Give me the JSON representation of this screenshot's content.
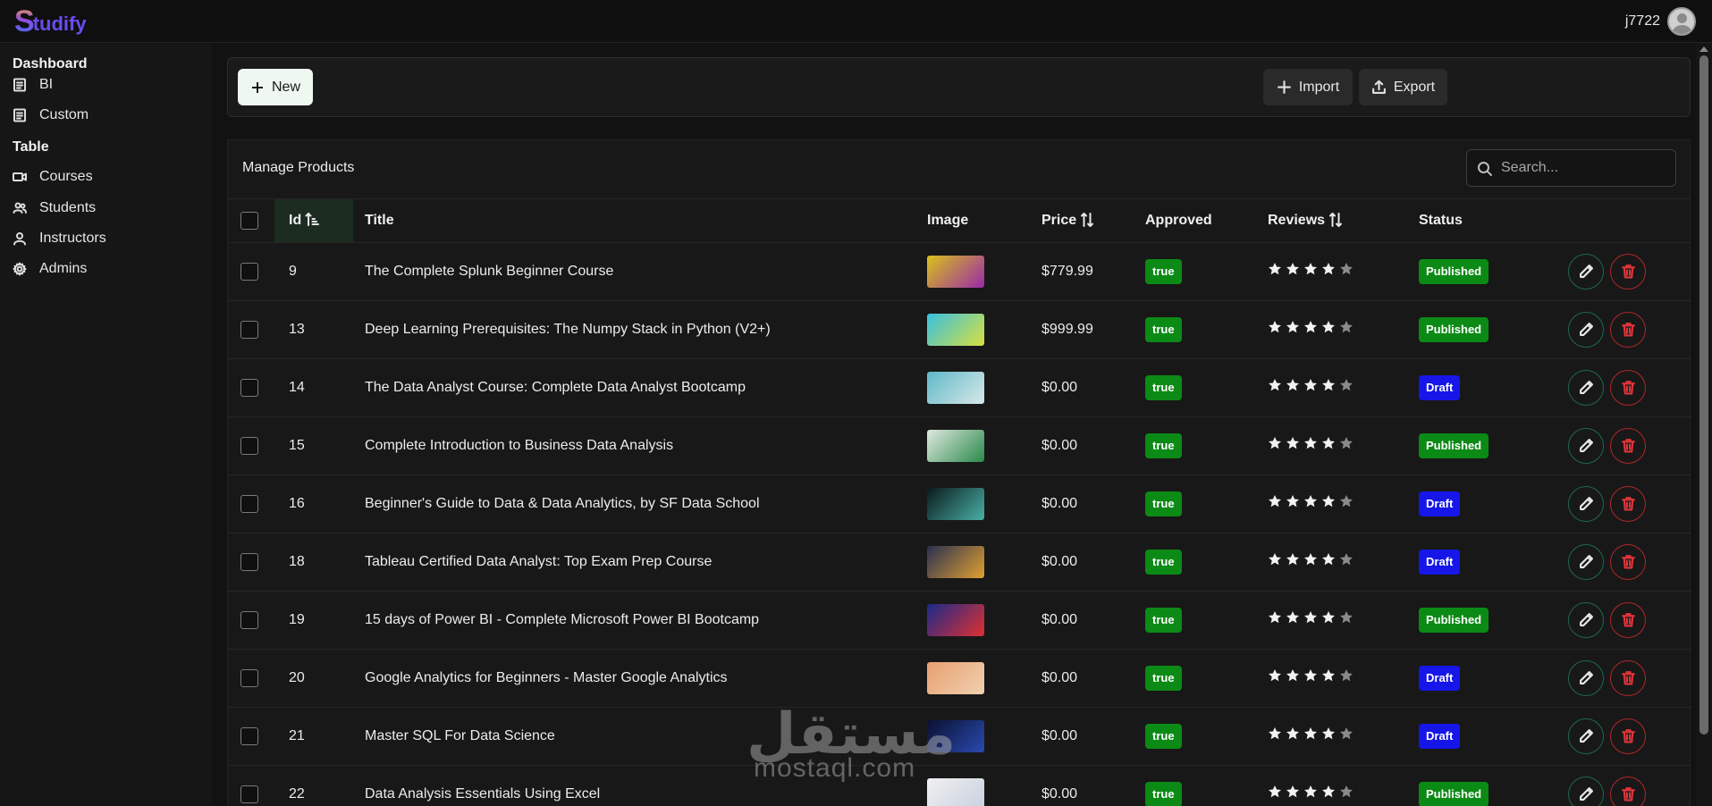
{
  "app": {
    "logo_initial": "S",
    "logo_rest": "tudify",
    "user_name": "j7722"
  },
  "sidebar": {
    "sections": [
      {
        "label": "Dashboard",
        "items": [
          {
            "label": "BI",
            "icon": "list-icon"
          },
          {
            "label": "Custom",
            "icon": "list-icon"
          }
        ]
      },
      {
        "label": "Table",
        "items": [
          {
            "label": "Courses",
            "icon": "video-icon"
          },
          {
            "label": "Students",
            "icon": "users-icon"
          },
          {
            "label": "Instructors",
            "icon": "user-icon"
          },
          {
            "label": "Admins",
            "icon": "gear-icon"
          }
        ]
      }
    ]
  },
  "toolbar": {
    "new_label": "New",
    "import_label": "Import",
    "export_label": "Export"
  },
  "panel": {
    "title": "Manage Products",
    "search_placeholder": "Search..."
  },
  "table": {
    "columns": {
      "id": "Id",
      "title": "Title",
      "image": "Image",
      "price": "Price",
      "approved": "Approved",
      "reviews": "Reviews",
      "status": "Status"
    },
    "rows": [
      {
        "id": "9",
        "title": "The Complete Splunk Beginner Course",
        "price": "$779.99",
        "approved": "true",
        "rating": 4,
        "status": "Published",
        "thumb": [
          "#d8c21a",
          "#9a2aa8"
        ]
      },
      {
        "id": "13",
        "title": "Deep Learning Prerequisites: The Numpy Stack in Python (V2+)",
        "price": "$999.99",
        "approved": "true",
        "rating": 4,
        "status": "Published",
        "thumb": [
          "#38c0e0",
          "#d8e040"
        ]
      },
      {
        "id": "14",
        "title": "The Data Analyst Course: Complete Data Analyst Bootcamp",
        "price": "$0.00",
        "approved": "true",
        "rating": 4,
        "status": "Draft",
        "thumb": [
          "#5fb8c8",
          "#d8e8e8"
        ]
      },
      {
        "id": "15",
        "title": "Complete Introduction to Business Data Analysis",
        "price": "$0.00",
        "approved": "true",
        "rating": 4,
        "status": "Published",
        "thumb": [
          "#e0e8e0",
          "#2a8a4a"
        ]
      },
      {
        "id": "16",
        "title": "Beginner's Guide to Data & Data Analytics, by SF Data School",
        "price": "$0.00",
        "approved": "true",
        "rating": 4,
        "status": "Draft",
        "thumb": [
          "#0a1a1a",
          "#4ab0a8"
        ]
      },
      {
        "id": "18",
        "title": "Tableau Certified Data Analyst: Top Exam Prep Course",
        "price": "$0.00",
        "approved": "true",
        "rating": 4,
        "status": "Draft",
        "thumb": [
          "#2a3050",
          "#e0a030"
        ]
      },
      {
        "id": "19",
        "title": "15 days of Power BI - Complete Microsoft Power BI Bootcamp",
        "price": "$0.00",
        "approved": "true",
        "rating": 4,
        "status": "Published",
        "thumb": [
          "#1a2a8a",
          "#e03030"
        ]
      },
      {
        "id": "20",
        "title": "Google Analytics for Beginners - Master Google Analytics",
        "price": "$0.00",
        "approved": "true",
        "rating": 4,
        "status": "Draft",
        "thumb": [
          "#e8a070",
          "#f0d0b0"
        ]
      },
      {
        "id": "21",
        "title": "Master SQL For Data Science",
        "price": "$0.00",
        "approved": "true",
        "rating": 4,
        "status": "Draft",
        "thumb": [
          "#0a1030",
          "#2a4ab0"
        ]
      },
      {
        "id": "22",
        "title": "Data Analysis Essentials Using Excel",
        "price": "$0.00",
        "approved": "true",
        "rating": 4,
        "status": "Published",
        "thumb": [
          "#f0f0f0",
          "#c8d0e0"
        ]
      }
    ]
  },
  "watermark": {
    "arabic": "مستقل",
    "latin": "mostaql.com"
  },
  "colors": {
    "accent_green": "#0c8a16",
    "draft_blue": "#1616e8",
    "edit_border": "#1d6a45",
    "delete_border": "#b0262a"
  }
}
